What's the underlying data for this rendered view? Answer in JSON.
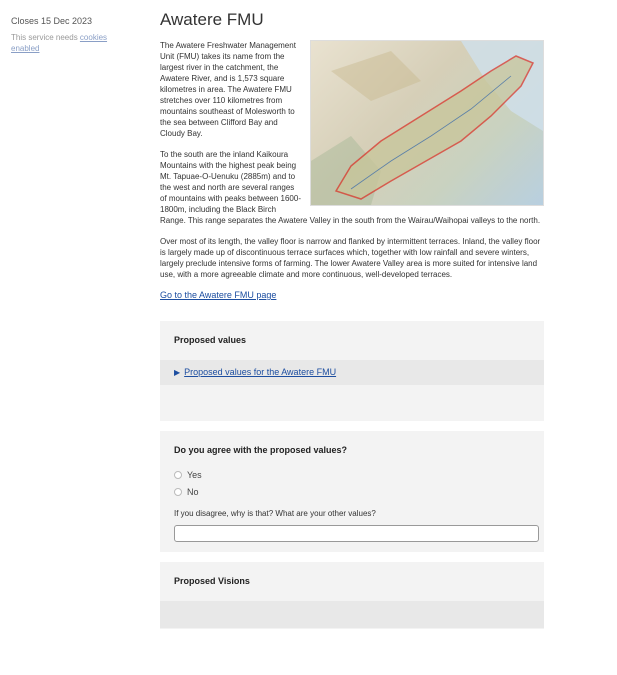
{
  "sidebar": {
    "closes": "Closes 15 Dec 2023",
    "cookie_note": "This service needs ",
    "cookie_link": "cookies enabled"
  },
  "page": {
    "title": "Awatere FMU",
    "para1": "The Awatere Freshwater Management Unit (FMU) takes its name from the largest river in the catchment, the Awatere River, and is 1,573 square kilometres in area. The Awatere FMU stretches over 110 kilometres from mountains southeast of Molesworth to the sea between Clifford Bay and Cloudy Bay.",
    "para2": "To the south are the inland Kaikoura Mountains with the highest peak being Mt. Tapuae-O-Uenuku (2885m) and to the west and north are several ranges of mountains with peaks between 1600-1800m, including the Black Birch Range. This range separates the Awatere Valley in the south from the Wairau/Waihopai valleys to the north.",
    "para3": "Over most of its length, the valley floor is narrow and flanked by intermittent terraces. Inland, the valley floor is largely made up of discontinuous terrace surfaces which, together with low rainfall and severe winters, largely preclude intensive forms of farming. The lower Awatere Valley area is more suited for intensive land use, with a more agreeable climate and more continuous, well-developed terraces.",
    "fmu_link": "Go to the Awatere FMU page"
  },
  "proposed_values": {
    "heading": "Proposed values",
    "details_label": "Proposed values for the Awatere FMU"
  },
  "agree_question": {
    "heading": "Do you agree with the proposed values?",
    "options": [
      "Yes",
      "No"
    ],
    "followup_label": "If you disagree, why is that? What are your other values?",
    "followup_value": ""
  },
  "proposed_visions": {
    "heading": "Proposed Visions"
  },
  "colors": {
    "link": "#1d4ea0",
    "panel_bg": "#f3f3f3",
    "details_bg": "#e8e8e8",
    "map_outline": "#d9352a"
  },
  "icons": {
    "details_toggle": "triangle-right-icon"
  }
}
